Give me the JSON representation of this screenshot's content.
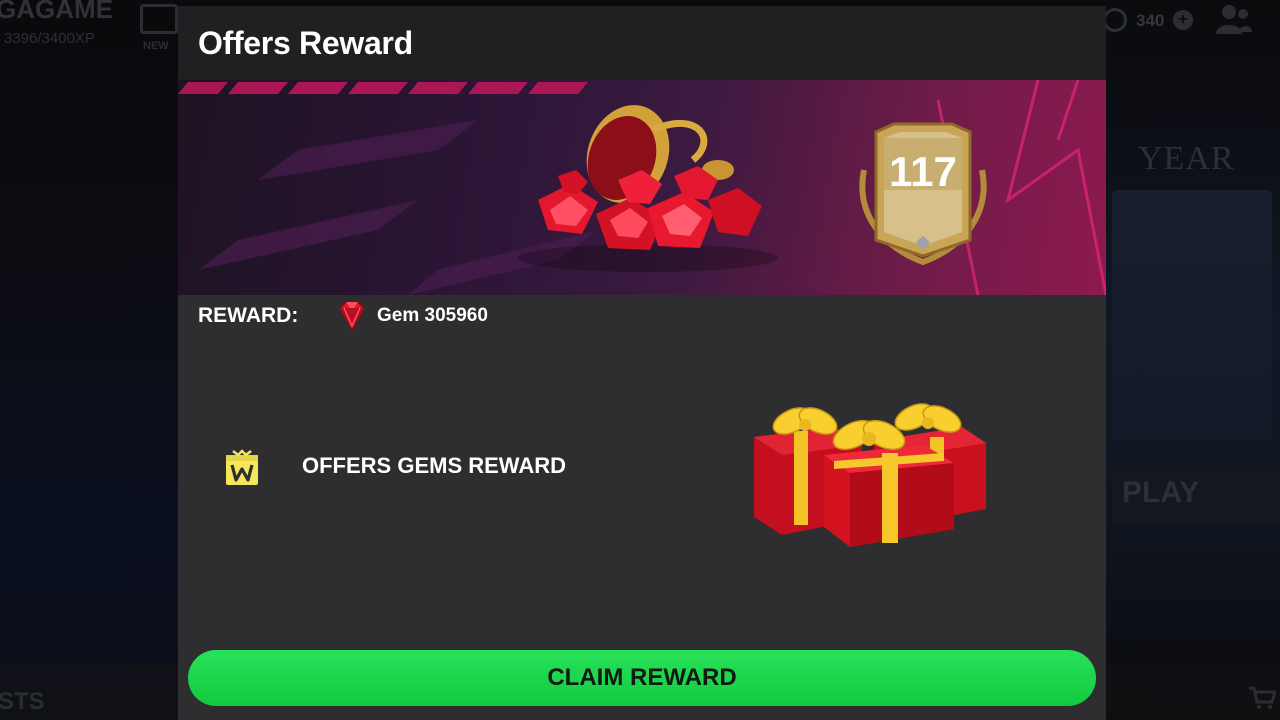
{
  "background": {
    "game_name": "GAGAME",
    "xp": "3396/3400XP",
    "news_label": "NEW",
    "coins": "340",
    "year_text": "YEAR",
    "play_label": "PLAY",
    "bottom_left_label": "STS"
  },
  "modal": {
    "title": "Offers Reward",
    "banner": {
      "card_rating": "117"
    },
    "reward": {
      "label": "REWARD:",
      "gem_amount": "Gem 305960"
    },
    "offer": {
      "label": "OFFERS GEMS REWARD"
    },
    "claim_button": "CLAIM REWARD"
  },
  "colors": {
    "claim_green": "#1fd84c",
    "gem_red": "#e0152b",
    "offer_icon_yellow": "#f5e65a",
    "modal_bg": "#2e2e30",
    "header_bg": "#202022"
  },
  "icons": [
    "news-icon",
    "coin-icon",
    "plus-icon",
    "friends-icon",
    "gem-icon",
    "offer-gift-icon",
    "cart-icon"
  ]
}
